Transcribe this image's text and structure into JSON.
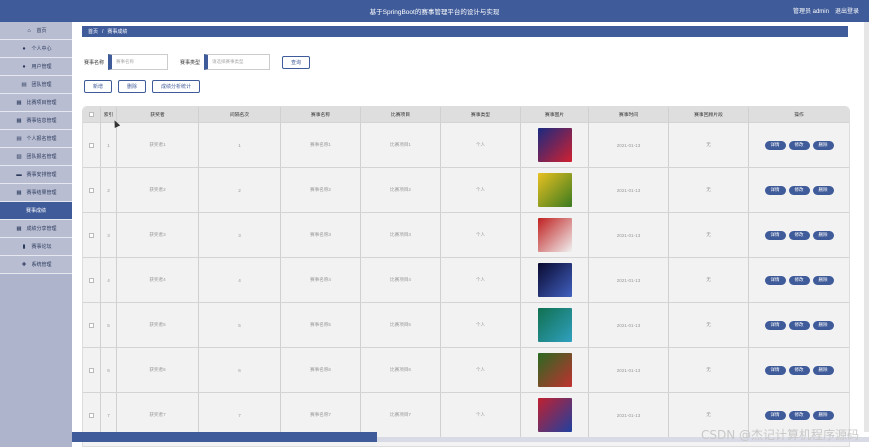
{
  "header": {
    "title": "基于SpringBoot的赛事管理平台的设计与实现",
    "user": "管理员 admin",
    "logout": "退出登录"
  },
  "sidebar": {
    "items": [
      {
        "label": "首页",
        "icon": "home-icon",
        "glyph": "⌂"
      },
      {
        "label": "个人中心",
        "icon": "user-icon",
        "glyph": "●"
      },
      {
        "label": "用户管理",
        "icon": "user-icon",
        "glyph": "●"
      },
      {
        "label": "团队管理",
        "icon": "card-icon",
        "glyph": "▤"
      },
      {
        "label": "比赛项目管理",
        "icon": "grid-icon",
        "glyph": "▦"
      },
      {
        "label": "赛事信息管理",
        "icon": "grid-icon",
        "glyph": "▦"
      },
      {
        "label": "个人报名管理",
        "icon": "card-icon",
        "glyph": "▤"
      },
      {
        "label": "团队报名管理",
        "icon": "doc-icon",
        "glyph": "▧"
      },
      {
        "label": "赛事安排管理",
        "icon": "monitor-icon",
        "glyph": "▬"
      },
      {
        "label": "赛事结果管理",
        "icon": "grid-icon",
        "glyph": "▦"
      },
      {
        "label": "赛事成绩",
        "icon": "",
        "glyph": ""
      },
      {
        "label": "成绩分享管理",
        "icon": "grid-icon",
        "glyph": "▦"
      },
      {
        "label": "赛事论坛",
        "icon": "bars-icon",
        "glyph": "▮"
      },
      {
        "label": "系统管理",
        "icon": "pin-icon",
        "glyph": "✚"
      }
    ]
  },
  "breadcrumb": {
    "home": "首页",
    "sep": "/",
    "current": "赛事成绩"
  },
  "search": {
    "name_label": "赛事名称",
    "name_placeholder": "赛事名称",
    "type_label": "赛事类型",
    "type_placeholder": "请选择赛事类型",
    "query_button": "查询"
  },
  "actions": {
    "add": "新增",
    "delete": "删除",
    "stats": "成绩分析统计"
  },
  "table": {
    "headers": [
      "索引",
      "获奖者",
      "间隔名次",
      "赛事名称",
      "比赛项目",
      "赛事类型",
      "赛事图片",
      "赛事时间",
      "赛事回顾片段",
      "操作"
    ],
    "ops": {
      "detail": "详情",
      "edit": "修改",
      "delete": "删除"
    },
    "rows": [
      {
        "idx": "1",
        "winner": "获奖者1",
        "rank": "1",
        "match": "赛事名称1",
        "item": "比赛项目1",
        "type": "个人",
        "time": "2021-01-13",
        "review": "无",
        "img_colors": [
          "#1a2a80",
          "#d02030"
        ]
      },
      {
        "idx": "2",
        "winner": "获奖者2",
        "rank": "2",
        "match": "赛事名称2",
        "item": "比赛项目2",
        "type": "个人",
        "time": "2021-01-13",
        "review": "无",
        "img_colors": [
          "#e8c020",
          "#3a7a20"
        ]
      },
      {
        "idx": "3",
        "winner": "获奖者3",
        "rank": "3",
        "match": "赛事名称3",
        "item": "比赛项目3",
        "type": "个人",
        "time": "2021-01-13",
        "review": "无",
        "img_colors": [
          "#c02020",
          "#f0f0f0"
        ]
      },
      {
        "idx": "4",
        "winner": "获奖者4",
        "rank": "4",
        "match": "赛事名称4",
        "item": "比赛项目4",
        "type": "个人",
        "time": "2021-01-13",
        "review": "无",
        "img_colors": [
          "#0a0a30",
          "#4060c0"
        ]
      },
      {
        "idx": "5",
        "winner": "获奖者5",
        "rank": "5",
        "match": "赛事名称5",
        "item": "比赛项目5",
        "type": "个人",
        "time": "2021-01-13",
        "review": "无",
        "img_colors": [
          "#107050",
          "#30a0c0"
        ]
      },
      {
        "idx": "6",
        "winner": "获奖者6",
        "rank": "6",
        "match": "赛事名称6",
        "item": "比赛项目6",
        "type": "个人",
        "time": "2021-01-13",
        "review": "无",
        "img_colors": [
          "#2a6a20",
          "#c03030"
        ]
      },
      {
        "idx": "7",
        "winner": "获奖者7",
        "rank": "7",
        "match": "赛事名称7",
        "item": "比赛项目7",
        "type": "个人",
        "time": "2021-01-13",
        "review": "无",
        "img_colors": [
          "#c02030",
          "#2040a0"
        ]
      }
    ]
  },
  "watermark": "CSDN @杰记计算机程序源码"
}
